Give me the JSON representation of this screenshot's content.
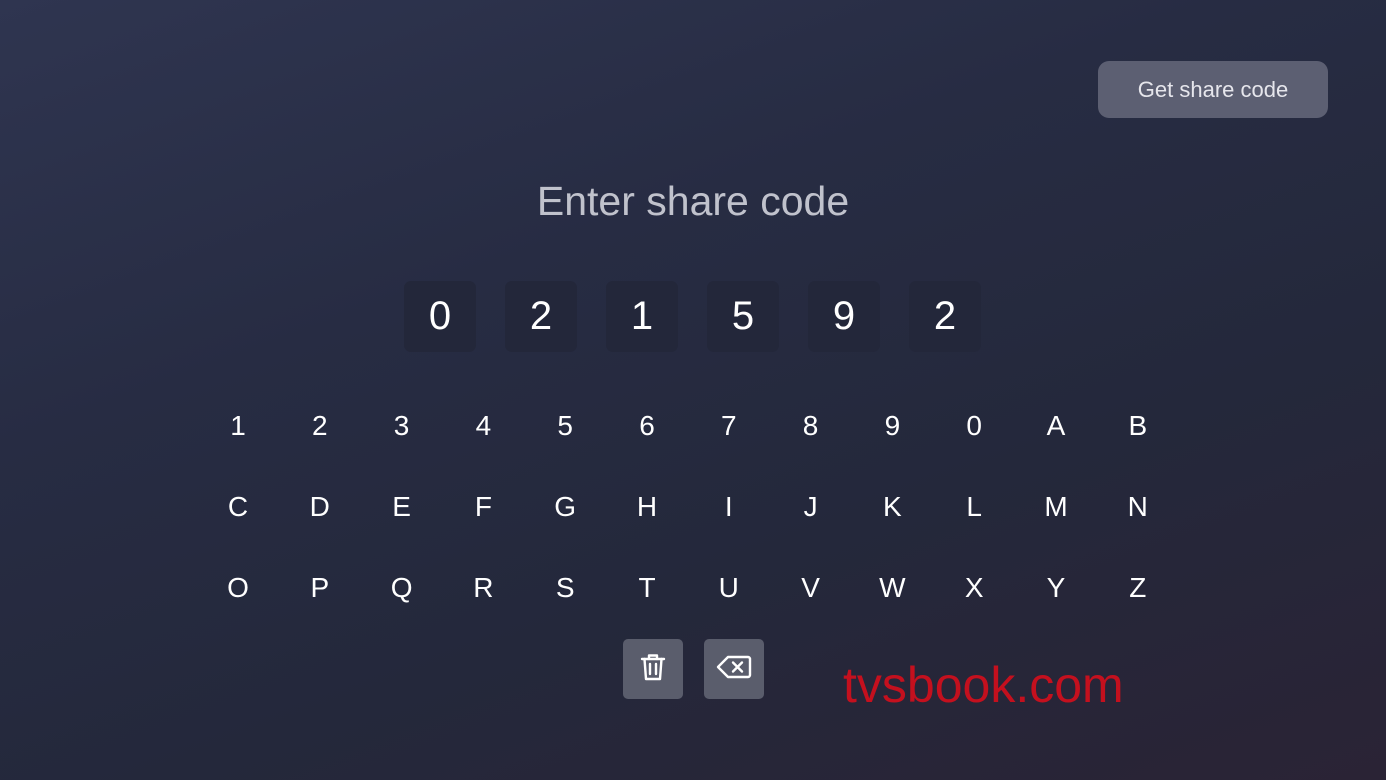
{
  "header": {
    "share_button_label": "Get share code"
  },
  "main": {
    "title": "Enter share code",
    "code_digits": [
      "0",
      "2",
      "1",
      "5",
      "9",
      "2"
    ]
  },
  "keyboard": {
    "rows": [
      [
        "1",
        "2",
        "3",
        "4",
        "5",
        "6",
        "7",
        "8",
        "9",
        "0",
        "A",
        "B"
      ],
      [
        "C",
        "D",
        "E",
        "F",
        "G",
        "H",
        "I",
        "J",
        "K",
        "L",
        "M",
        "N"
      ],
      [
        "O",
        "P",
        "Q",
        "R",
        "S",
        "T",
        "U",
        "V",
        "W",
        "X",
        "Y",
        "Z"
      ]
    ],
    "actions": [
      {
        "name": "clear-all-button",
        "icon": "trash-icon"
      },
      {
        "name": "backspace-button",
        "icon": "backspace-icon"
      }
    ]
  },
  "watermark": {
    "text": "tvsbook.com",
    "color": "#c4101e"
  }
}
